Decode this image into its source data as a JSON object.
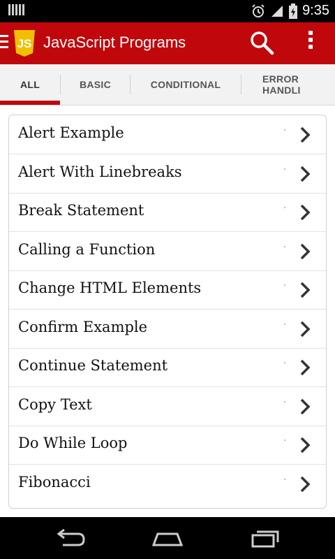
{
  "status_bar": {
    "time": "9:35"
  },
  "app_bar": {
    "title": "JavaScript Programs",
    "logo_text": "JS"
  },
  "tabs": [
    {
      "label": "ALL",
      "active": true
    },
    {
      "label": "BASIC",
      "active": false
    },
    {
      "label": "CONDITIONAL",
      "active": false
    },
    {
      "label": "ERROR HANDLI",
      "active": false
    }
  ],
  "programs": [
    {
      "label": "Alert Example"
    },
    {
      "label": "Alert With Linebreaks"
    },
    {
      "label": "Break Statement"
    },
    {
      "label": "Calling a Function"
    },
    {
      "label": "Change HTML Elements"
    },
    {
      "label": "Confirm Example"
    },
    {
      "label": "Continue Statement"
    },
    {
      "label": "Copy Text"
    },
    {
      "label": "Do While Loop"
    },
    {
      "label": "Fibonacci"
    }
  ],
  "colors": {
    "accent": "#c0080c",
    "logo": "#f0c000",
    "tab_bar": "#f2f2f2"
  },
  "icons": {
    "app_bar": [
      "drawer-icon",
      "js-logo-icon",
      "search-icon",
      "more-vert-icon"
    ],
    "nav": [
      "back-icon",
      "home-icon",
      "recents-icon"
    ],
    "list": "chevron-right-icon"
  }
}
